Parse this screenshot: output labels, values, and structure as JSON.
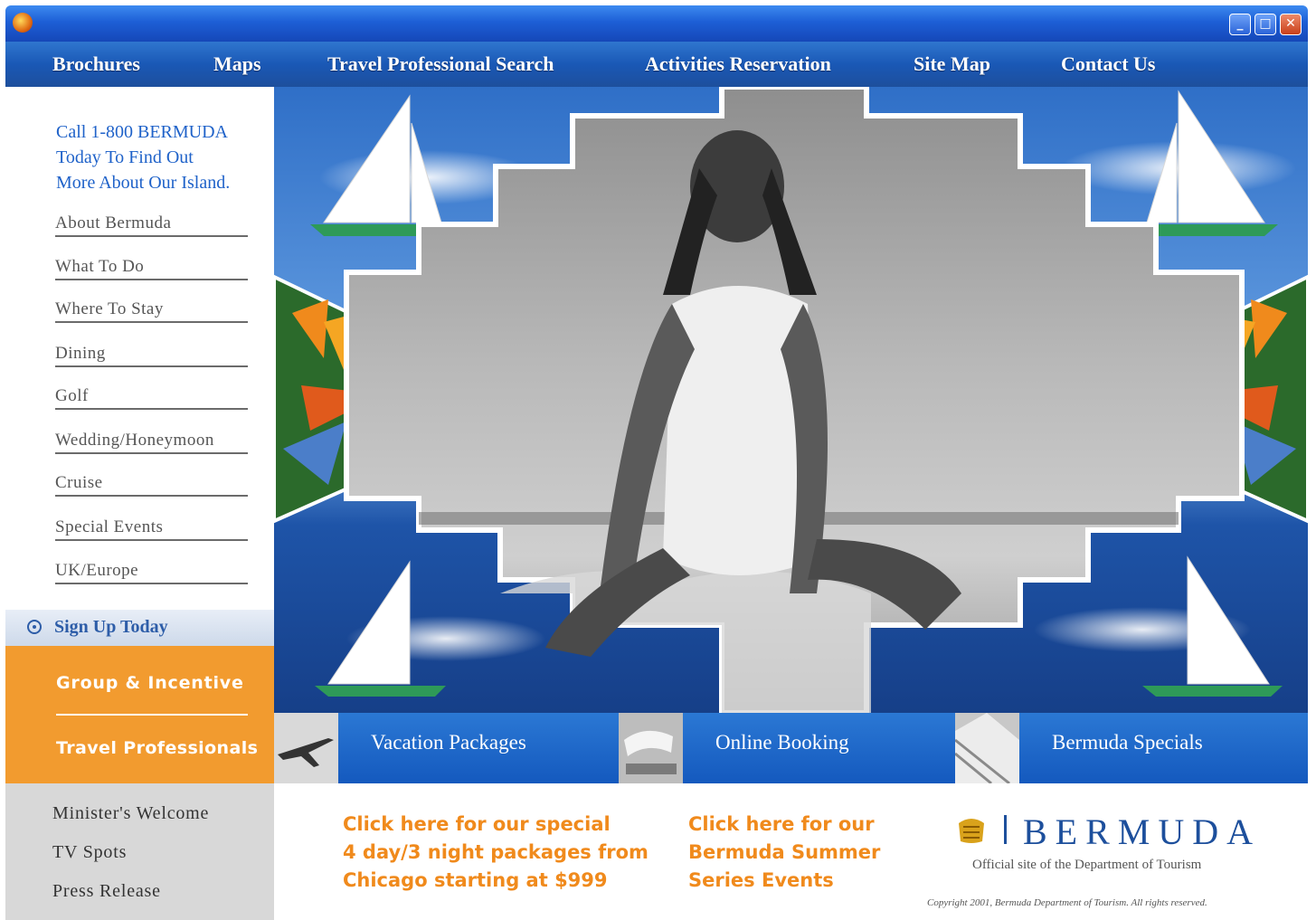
{
  "top_nav": [
    "Brochures",
    "Maps",
    "Travel Professional Search",
    "Activities Reservation",
    "Site Map",
    "Contact Us"
  ],
  "sidebar": {
    "call_lines": [
      "Call 1-800 BERMUDA",
      "Today To Find Out",
      "More About Our Island."
    ],
    "links": [
      "About Bermuda",
      "What To Do",
      "Where To Stay",
      "Dining",
      "Golf",
      "Wedding/Honeymoon",
      "Cruise",
      "Special Events",
      "UK/Europe"
    ],
    "signup": "Sign Up Today",
    "orange_links": [
      "Group & Incentive",
      "Travel Professionals"
    ],
    "grey_links": [
      "Minister's Welcome",
      "TV Spots",
      "Press Release"
    ]
  },
  "promos": [
    "Vacation Packages",
    "Online Booking",
    "Bermuda Specials"
  ],
  "offers": {
    "packages": [
      "Click here for our special",
      "4 day/3 night packages from",
      "Chicago starting at $999"
    ],
    "events": [
      "Click here for our",
      "Bermuda Summer",
      "Series Events"
    ]
  },
  "brand": {
    "name": "BERMUDA",
    "subtitle": "Official site of the Department of Tourism",
    "copyright": "Copyright 2001, Bermuda Department of Tourism. All rights reserved."
  },
  "colors": {
    "nav_blue": "#1a58b6",
    "link_blue": "#1f62c9",
    "orange": "#f29b2f",
    "offer_orange": "#f08a1c",
    "grey_panel": "#d8d8d8"
  },
  "icons": {
    "window_controls": [
      "minimize-icon",
      "maximize-icon",
      "close-icon"
    ],
    "signup": "radio-circle-icon",
    "crest": "bermuda-crest-icon"
  }
}
